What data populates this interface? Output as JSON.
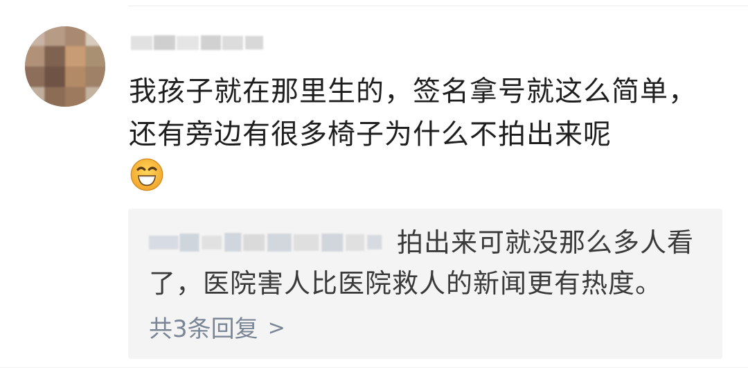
{
  "comment": {
    "text": "我孩子就在那里生的，签名拿号就这么简单，还有旁边有很多椅子为什么不拍出来呢",
    "emoji": "grin-emoji"
  },
  "reply": {
    "text_line1": "拍出来可就没那么多人看",
    "text_line2": "了，医院害人比医院救人的新闻更有热度。",
    "count_label": "共3条回复",
    "chevron": ">"
  },
  "colors": {
    "background": "#ffffff",
    "reply_background": "#f4f4f4",
    "text_primary": "#1e1e1e",
    "text_secondary": "#3a3a3a",
    "link_gray_blue": "#7a8596",
    "emoji_yellow": "#f7c63f",
    "emoji_orange": "#f0a92c"
  }
}
